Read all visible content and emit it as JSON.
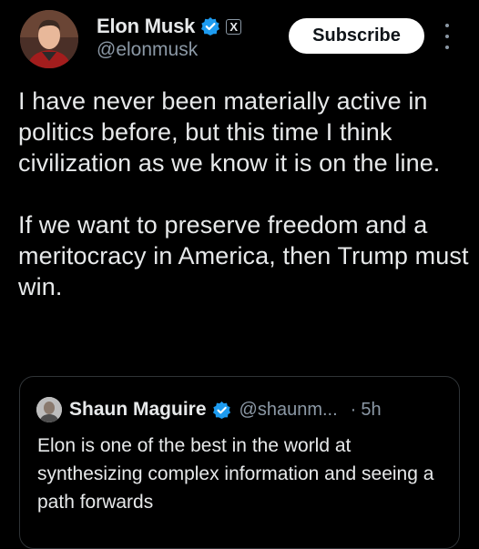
{
  "author": {
    "display_name": "Elon Musk",
    "handle": "@elonmusk",
    "affiliate_badge": "X"
  },
  "actions": {
    "subscribe_label": "Subscribe"
  },
  "tweet": {
    "paragraph_1": "I have never been materially active in politics before, but this time I think civilization as we know it is on the line.",
    "paragraph_2": "If we want to preserve freedom and a meritocracy in America, then Trump must win."
  },
  "quoted_tweet": {
    "display_name": "Shaun Maguire",
    "handle": "@shaunm...",
    "separator": "·",
    "time": "5h",
    "text": "Elon is one of the best in the world at synthesizing complex information and seeing a path forwards"
  },
  "colors": {
    "background": "#000000",
    "primary_text": "#e7e9ea",
    "secondary_text": "#8b98a5",
    "verified_blue": "#1d9bf0",
    "border": "#2f3336"
  },
  "icons": {
    "verified": "verified-badge-icon",
    "more": "more-options-icon"
  }
}
